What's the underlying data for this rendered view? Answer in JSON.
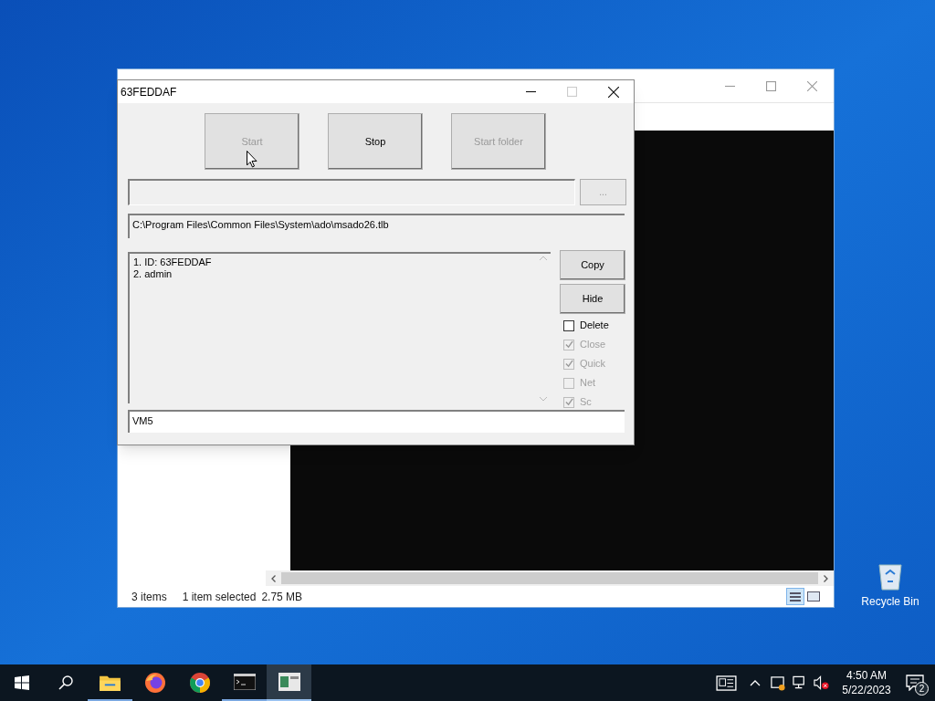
{
  "explorer": {
    "status_bar": {
      "item_count": "3 items",
      "selection": "1 item selected",
      "size": "2.75 MB"
    }
  },
  "dialog": {
    "title": "63FEDDAF",
    "top_buttons": [
      {
        "label": "Start",
        "disabled": true
      },
      {
        "label": "Stop",
        "disabled": false
      },
      {
        "label": "Start folder",
        "disabled": true
      }
    ],
    "browse_button": "...",
    "path_field": "C:\\Program Files\\Common Files\\System\\ado\\msado26.tlb",
    "list_lines": [
      "1. ID: 63FEDDAF",
      "2. admin"
    ],
    "side_buttons": [
      "Copy",
      "Hide"
    ],
    "checkboxes": [
      {
        "label": "Delete",
        "checked": false,
        "disabled": false
      },
      {
        "label": "Close",
        "checked": true,
        "disabled": true
      },
      {
        "label": "Quick",
        "checked": true,
        "disabled": true
      },
      {
        "label": "Net",
        "checked": false,
        "disabled": true
      },
      {
        "label": "Sc",
        "checked": true,
        "disabled": true
      }
    ],
    "bottom_field": "VM5"
  },
  "desktop_icons": [
    {
      "label": "Recycle Bin"
    }
  ],
  "taskbar": {
    "time": "4:50 AM",
    "date": "5/22/2023",
    "notification_count": "2"
  }
}
